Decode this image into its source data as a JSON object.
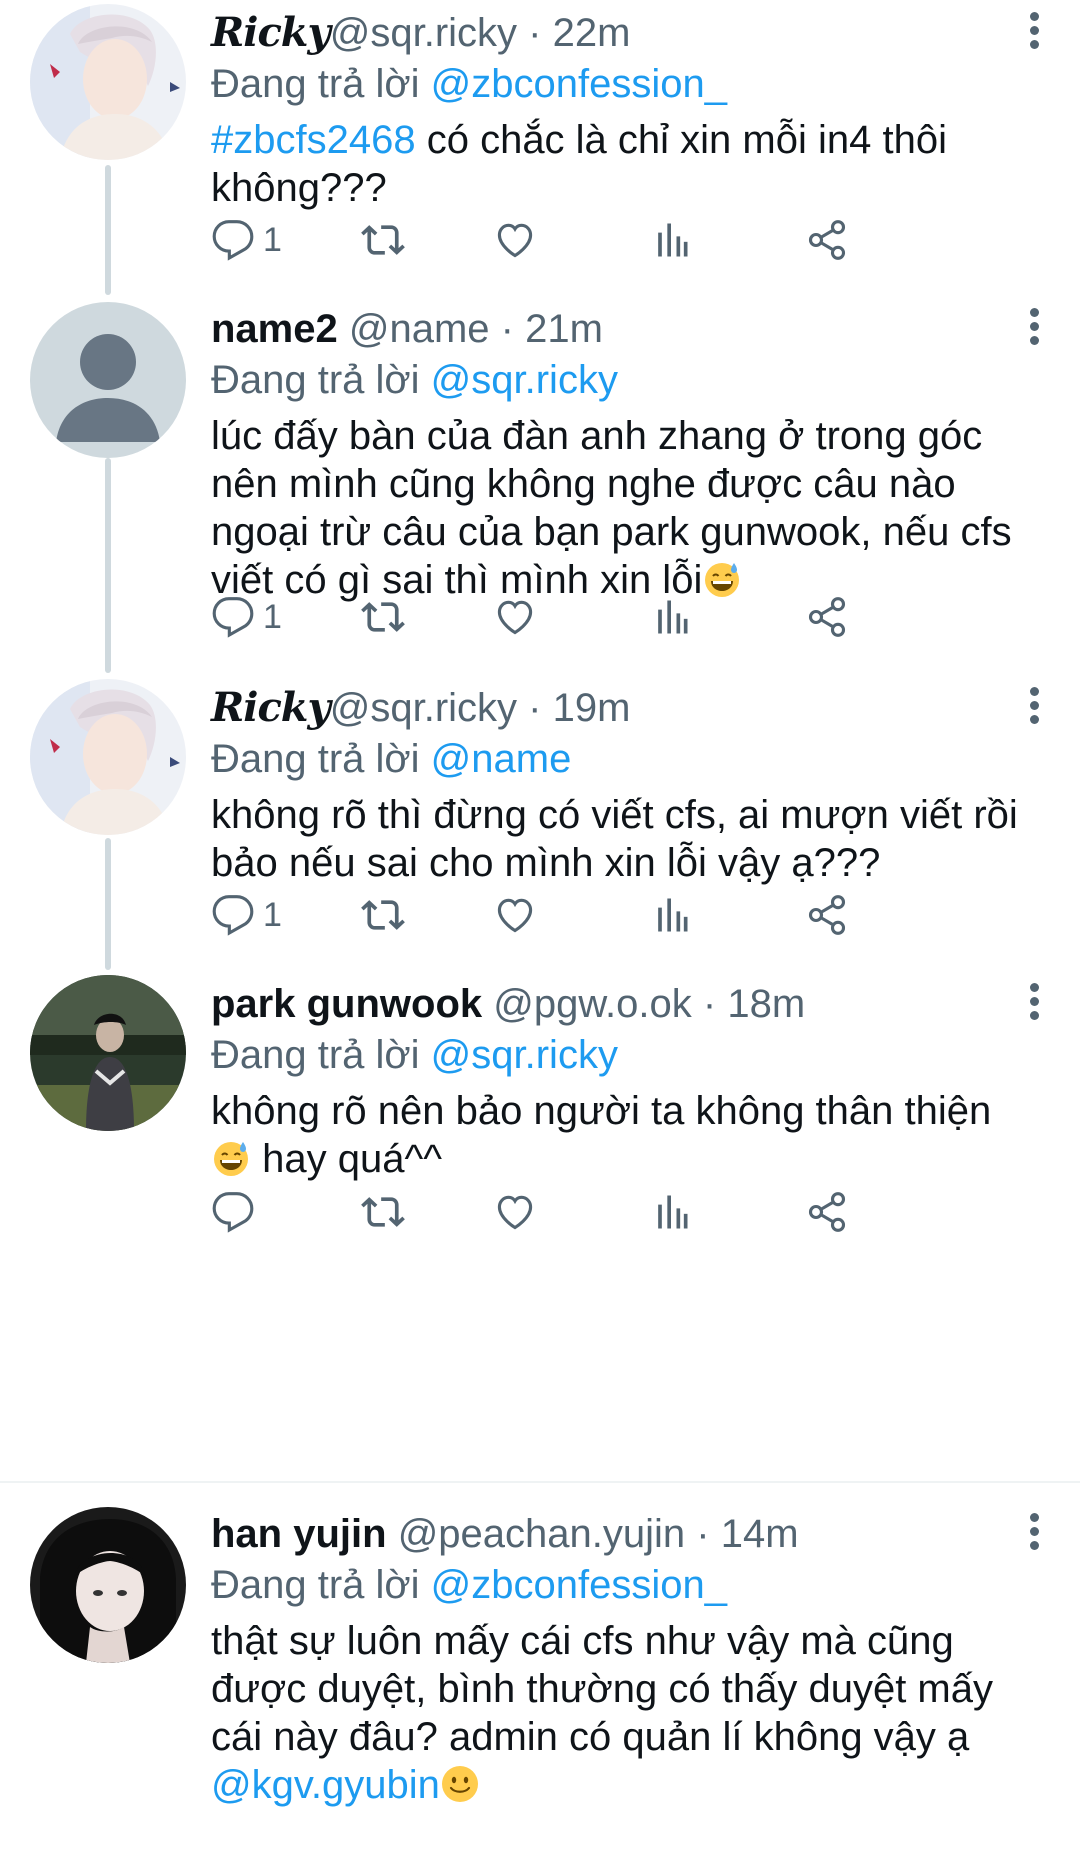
{
  "colors": {
    "link": "#1d9bf0",
    "muted": "#536471",
    "text": "#0f1419",
    "thread": "#cfd9de"
  },
  "tweets": [
    {
      "display_name": "Ricky",
      "handle": "@sqr.ricky",
      "dot": "·",
      "time": "22m",
      "reply_prefix": "Đang trả lời ",
      "reply_to": "@zbconfession_",
      "hashtag": "#zbcfs2468",
      "text": " có chắc là chỉ xin mỗi in4 thôi không???",
      "reply_count": "1",
      "avatar": "ricky-avatar"
    },
    {
      "display_name": "name2",
      "handle": "@name",
      "dot": "·",
      "time": "21m",
      "reply_prefix": "Đang trả lời ",
      "reply_to": "@sqr.ricky",
      "text": "lúc đấy bàn của đàn anh zhang ở trong góc nên mình cũng không nghe được câu nào ngoại trừ câu của bạn park gunwook, nếu cfs viết có gì sai thì mình xin lỗi",
      "emoji": "grinning-sweat-emoji",
      "reply_count": "1",
      "avatar": "default-avatar"
    },
    {
      "display_name": "Ricky",
      "handle": "@sqr.ricky",
      "dot": "·",
      "time": "19m",
      "reply_prefix": "Đang trả lời ",
      "reply_to": "@name",
      "text": "không rõ thì đừng có viết cfs, ai mượn viết rồi bảo nếu sai cho mình xin lỗi vậy ạ???",
      "reply_count": "1",
      "avatar": "ricky-avatar"
    },
    {
      "display_name": "park gunwook",
      "handle": "@pgw.o.ok",
      "dot": "·",
      "time": "18m",
      "reply_prefix": "Đang trả lời ",
      "reply_to": "@sqr.ricky",
      "text_before_emoji": "không rõ nên bảo người ta không thân thiện ",
      "emoji": "grinning-sweat-emoji",
      "text_after_emoji": " hay quá^^",
      "reply_count": "",
      "avatar": "park-avatar"
    },
    {
      "display_name": "han yujin",
      "handle": "@peachan.yujin",
      "dot": "·",
      "time": "14m",
      "reply_prefix": "Đang trả lời ",
      "reply_to": "@zbconfession_",
      "text": "thật sự luôn mấy cái cfs như vậy mà cũng được duyệt, bình thường có thấy duyệt mấy cái này đâu? admin có quản lí không vậy ạ ",
      "mention": "@kgv.gyubin",
      "emoji": "slight-smile-emoji",
      "reply_count": "",
      "avatar": "yujin-avatar"
    }
  ]
}
